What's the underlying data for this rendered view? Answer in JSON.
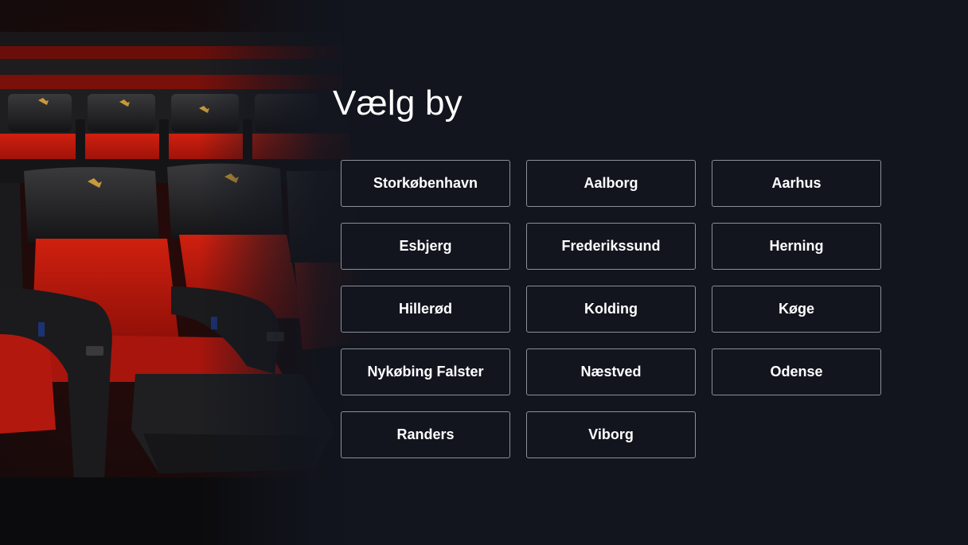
{
  "page": {
    "title": "Vælg by"
  },
  "cities": [
    {
      "label": "Storkøbenhavn"
    },
    {
      "label": "Aalborg"
    },
    {
      "label": "Aarhus"
    },
    {
      "label": "Esbjerg"
    },
    {
      "label": "Frederikssund"
    },
    {
      "label": "Herning"
    },
    {
      "label": "Hillerød"
    },
    {
      "label": "Kolding"
    },
    {
      "label": "Køge"
    },
    {
      "label": "Nykøbing Falster"
    },
    {
      "label": "Næstved"
    },
    {
      "label": "Odense"
    },
    {
      "label": "Randers"
    },
    {
      "label": "Viborg"
    }
  ],
  "colors": {
    "background": "#12151e",
    "seat_red": "#b8170f",
    "seat_black": "#1c1c1e",
    "button_border": "#8a8f9a",
    "text": "#ffffff"
  }
}
